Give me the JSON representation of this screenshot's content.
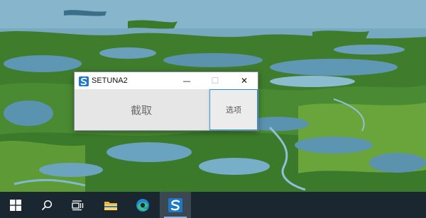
{
  "window": {
    "title": "SETUNA2",
    "minimize_symbol": "—",
    "maximize_symbol": "☐",
    "close_symbol": "✕",
    "capture_label": "截取",
    "options_label": "选项"
  },
  "taskbar": {
    "items": [
      {
        "name": "start",
        "icon": "windows-logo-icon"
      },
      {
        "name": "search",
        "icon": "search-icon"
      },
      {
        "name": "task-view",
        "icon": "task-view-icon"
      },
      {
        "name": "file-explorer",
        "icon": "folder-icon"
      },
      {
        "name": "edge",
        "icon": "edge-icon"
      },
      {
        "name": "setuna2",
        "icon": "setuna-icon",
        "active": true
      }
    ]
  },
  "colors": {
    "taskbar": "#1b2730",
    "accent": "#2a8ad4",
    "water": "#5b93ae",
    "marsh": "#3f7f2c"
  }
}
